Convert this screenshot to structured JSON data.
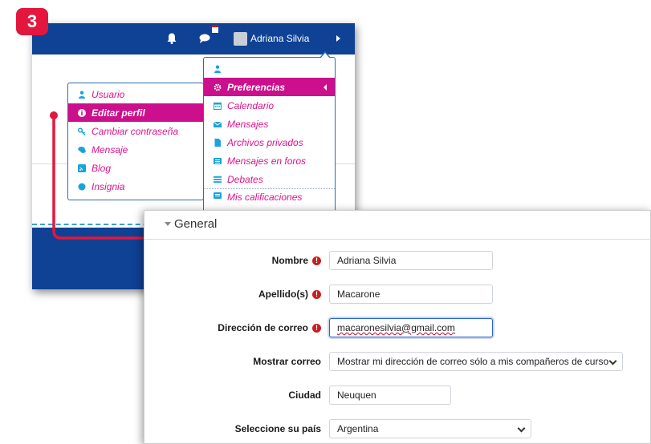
{
  "step_number": "3",
  "navbar": {
    "user_name": "Adriana Silvia",
    "bell_icon": "bell-icon",
    "chat_icon": "chat-icon",
    "flag_icon": "flag-icon"
  },
  "user_menu_left": {
    "items": [
      {
        "label": "Usuario",
        "icon": "user-icon"
      },
      {
        "label": "Editar perfil",
        "icon": "info-icon",
        "active": true
      },
      {
        "label": "Cambiar contraseña",
        "icon": "key-icon"
      },
      {
        "label": "Mensaje",
        "icon": "comments-icon"
      },
      {
        "label": "Blog",
        "icon": "rss-icon"
      },
      {
        "label": "Insignia",
        "icon": "circle-icon"
      }
    ]
  },
  "user_menu_right": {
    "items": [
      {
        "label": "",
        "icon": "user-icon"
      },
      {
        "label": "Preferencias",
        "icon": "cog-icon",
        "active": true
      },
      {
        "label": "Calendario",
        "icon": "calendar-icon"
      },
      {
        "label": "Mensajes",
        "icon": "envelope-icon"
      },
      {
        "label": "Archivos privados",
        "icon": "file-icon"
      },
      {
        "label": "Mensajes en foros",
        "icon": "list-icon"
      },
      {
        "label": "Debates",
        "icon": "list-icon"
      },
      {
        "label": "Mis calificaciones",
        "icon": "table-icon"
      }
    ]
  },
  "form": {
    "section_title": "General",
    "fields": [
      {
        "label": "Nombre",
        "required": true,
        "value": "Adriana Silvia",
        "type": "text"
      },
      {
        "label": "Apellido(s)",
        "required": true,
        "value": "Macarone",
        "type": "text"
      },
      {
        "label": "Dirección de correo",
        "required": true,
        "value": "macaronesilvia@gmail.com",
        "type": "email"
      },
      {
        "label": "Mostrar correo",
        "required": false,
        "value": "Mostrar mi dirección de correo sólo a mis compañeros de curso",
        "type": "select"
      },
      {
        "label": "Ciudad",
        "required": false,
        "value": "Neuquen",
        "type": "text"
      },
      {
        "label": "Seleccione su país",
        "required": false,
        "value": "Argentina",
        "type": "select"
      }
    ]
  },
  "colors": {
    "navbar": "#0f4194",
    "accent_magenta": "#cc0f8c",
    "badge_red": "#e3173e",
    "required_red": "#c81e1e"
  }
}
